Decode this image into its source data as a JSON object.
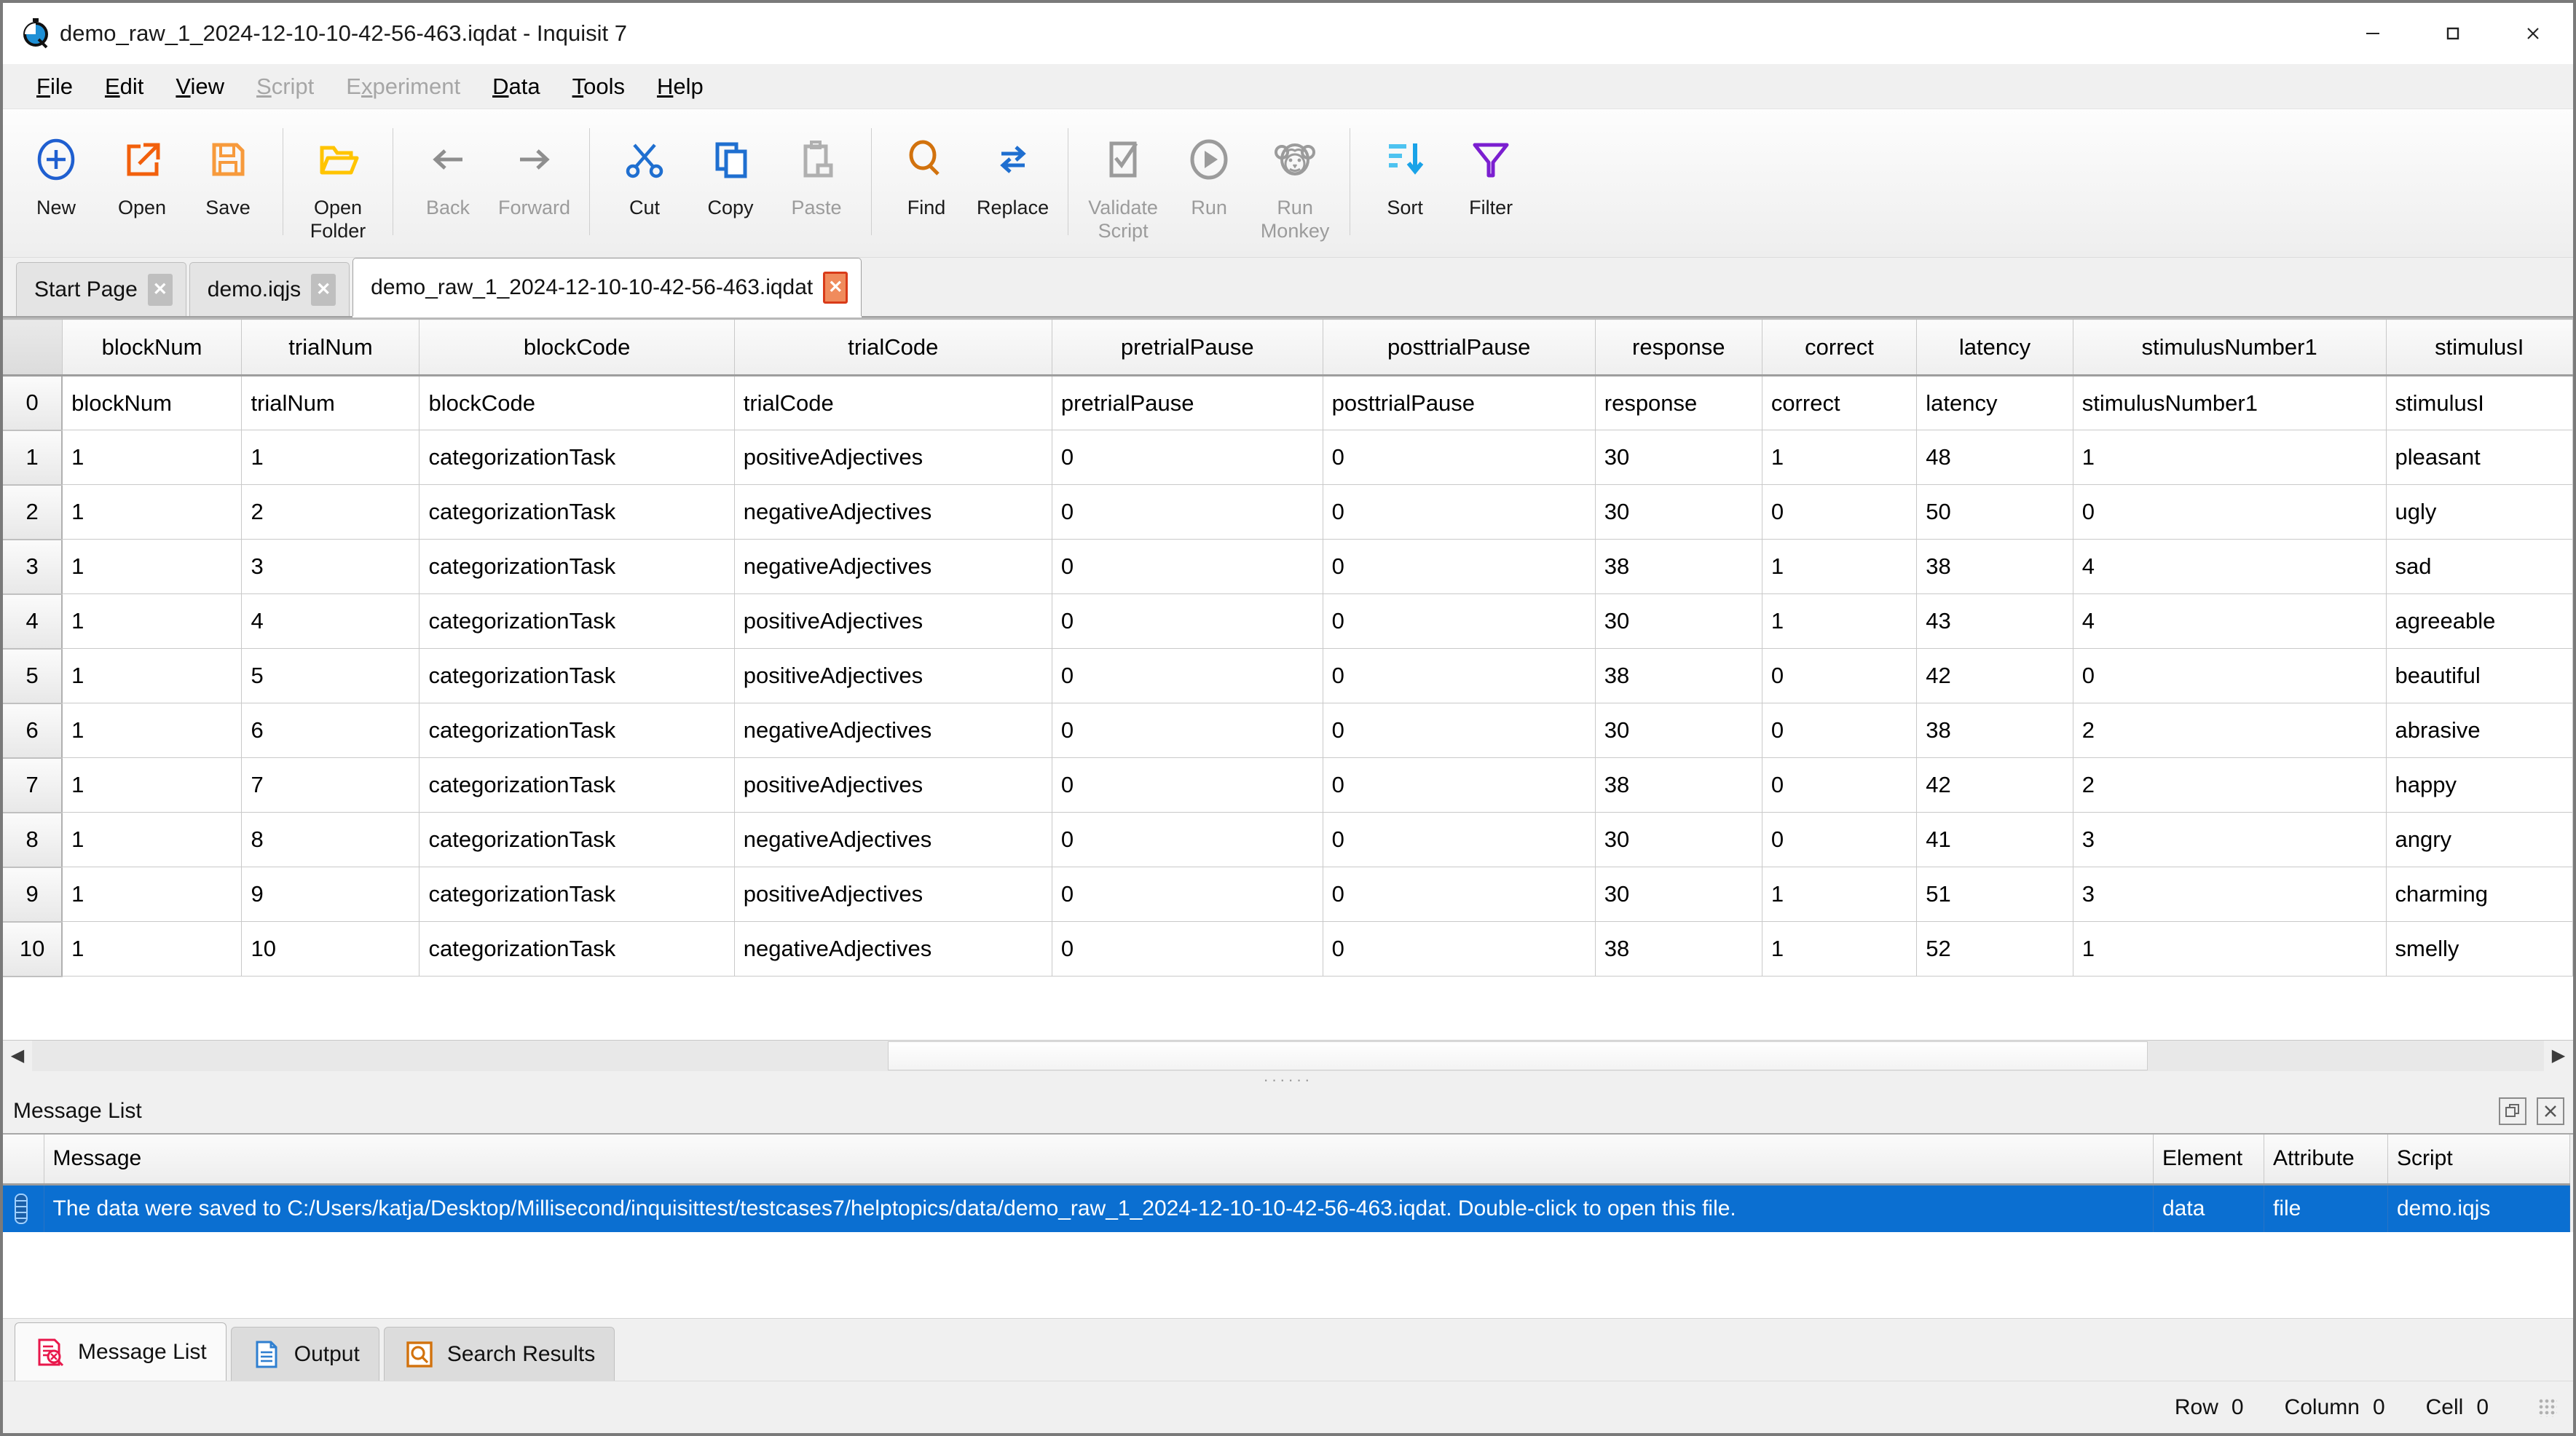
{
  "window": {
    "title": "demo_raw_1_2024-12-10-10-42-56-463.iqdat - Inquisit 7",
    "icon": "inquisit-stopwatch-icon",
    "minimize": "—",
    "maximize": "☐",
    "close": "✕"
  },
  "menubar": {
    "items": [
      {
        "label": "File",
        "mnemonic": "F",
        "disabled": false
      },
      {
        "label": "Edit",
        "mnemonic": "E",
        "disabled": false
      },
      {
        "label": "View",
        "mnemonic": "V",
        "disabled": false
      },
      {
        "label": "Script",
        "mnemonic": "S",
        "disabled": true
      },
      {
        "label": "Experiment",
        "mnemonic": "x",
        "disabled": true
      },
      {
        "label": "Data",
        "mnemonic": "D",
        "disabled": false
      },
      {
        "label": "Tools",
        "mnemonic": "T",
        "disabled": false
      },
      {
        "label": "Help",
        "mnemonic": "H",
        "disabled": false
      }
    ]
  },
  "toolbar": {
    "buttons": [
      {
        "label": "New",
        "icon": "plus-circle-icon",
        "disabled": false,
        "sep_after": false
      },
      {
        "label": "Open",
        "icon": "open-external-icon",
        "disabled": false,
        "sep_after": false
      },
      {
        "label": "Save",
        "icon": "floppy-disk-icon",
        "disabled": false,
        "sep_after": true
      },
      {
        "label": "Open\nFolder",
        "icon": "folder-open-icon",
        "disabled": false,
        "sep_after": true
      },
      {
        "label": "Back",
        "icon": "arrow-left-icon",
        "disabled": true,
        "sep_after": false
      },
      {
        "label": "Forward",
        "icon": "arrow-right-icon",
        "disabled": true,
        "sep_after": true
      },
      {
        "label": "Cut",
        "icon": "scissors-icon",
        "disabled": false,
        "sep_after": false
      },
      {
        "label": "Copy",
        "icon": "copy-icon",
        "disabled": false,
        "sep_after": false
      },
      {
        "label": "Paste",
        "icon": "paste-icon",
        "disabled": true,
        "sep_after": true
      },
      {
        "label": "Find",
        "icon": "magnifier-icon",
        "disabled": false,
        "sep_after": false
      },
      {
        "label": "Replace",
        "icon": "replace-arrows-icon",
        "disabled": false,
        "sep_after": true
      },
      {
        "label": "Validate\nScript",
        "icon": "checklist-icon",
        "disabled": true,
        "sep_after": false
      },
      {
        "label": "Run",
        "icon": "play-circle-icon",
        "disabled": true,
        "sep_after": false
      },
      {
        "label": "Run\nMonkey",
        "icon": "monkey-icon",
        "disabled": true,
        "sep_after": true
      },
      {
        "label": "Sort",
        "icon": "sort-descending-icon",
        "disabled": false,
        "sep_after": false
      },
      {
        "label": "Filter",
        "icon": "funnel-icon",
        "disabled": false,
        "sep_after": false
      }
    ]
  },
  "document_tabs": [
    {
      "label": "Start Page",
      "active": false,
      "close": "✕"
    },
    {
      "label": "demo.iqjs",
      "active": false,
      "close": "✕"
    },
    {
      "label": "demo_raw_1_2024-12-10-10-42-56-463.iqdat",
      "active": true,
      "close": "✕"
    }
  ],
  "grid": {
    "columns": [
      "blockNum",
      "trialNum",
      "blockCode",
      "trialCode",
      "pretrialPause",
      "posttrialPause",
      "response",
      "correct",
      "latency",
      "stimulusNumber1",
      "stimulusI"
    ],
    "row_labels": [
      "0",
      "1",
      "2",
      "3",
      "4",
      "5",
      "6",
      "7",
      "8",
      "9",
      "10"
    ],
    "rows": [
      [
        "blockNum",
        "trialNum",
        "blockCode",
        "trialCode",
        "pretrialPause",
        "posttrialPause",
        "response",
        "correct",
        "latency",
        "stimulusNumber1",
        "stimulusI"
      ],
      [
        "1",
        "1",
        "categorizationTask",
        "positiveAdjectives",
        "0",
        "0",
        "30",
        "1",
        "48",
        "1",
        "pleasant"
      ],
      [
        "1",
        "2",
        "categorizationTask",
        "negativeAdjectives",
        "0",
        "0",
        "30",
        "0",
        "50",
        "0",
        "ugly"
      ],
      [
        "1",
        "3",
        "categorizationTask",
        "negativeAdjectives",
        "0",
        "0",
        "38",
        "1",
        "38",
        "4",
        "sad"
      ],
      [
        "1",
        "4",
        "categorizationTask",
        "positiveAdjectives",
        "0",
        "0",
        "30",
        "1",
        "43",
        "4",
        "agreeable"
      ],
      [
        "1",
        "5",
        "categorizationTask",
        "positiveAdjectives",
        "0",
        "0",
        "38",
        "0",
        "42",
        "0",
        "beautiful"
      ],
      [
        "1",
        "6",
        "categorizationTask",
        "negativeAdjectives",
        "0",
        "0",
        "30",
        "0",
        "38",
        "2",
        "abrasive"
      ],
      [
        "1",
        "7",
        "categorizationTask",
        "positiveAdjectives",
        "0",
        "0",
        "38",
        "0",
        "42",
        "2",
        "happy"
      ],
      [
        "1",
        "8",
        "categorizationTask",
        "negativeAdjectives",
        "0",
        "0",
        "30",
        "0",
        "41",
        "3",
        "angry"
      ],
      [
        "1",
        "9",
        "categorizationTask",
        "positiveAdjectives",
        "0",
        "0",
        "30",
        "1",
        "51",
        "3",
        "charming"
      ],
      [
        "1",
        "10",
        "categorizationTask",
        "negativeAdjectives",
        "0",
        "0",
        "38",
        "1",
        "52",
        "1",
        "smelly"
      ]
    ]
  },
  "scrollbar": {
    "left_arrow": "◀",
    "right_arrow": "▶"
  },
  "message_panel": {
    "title": "Message List",
    "float_button": "❐",
    "close_button": "✕",
    "columns": [
      "Message",
      "Element",
      "Attribute",
      "Script"
    ],
    "rows": [
      {
        "icon": "message-info-icon",
        "message": "The data were saved to C:/Users/katja/Desktop/Millisecond/inquisittest/testcases7/helptopics/data/demo_raw_1_2024-12-10-10-42-56-463.iqdat. Double-click to open this file.",
        "element": "data",
        "attribute": "file",
        "script": "demo.iqjs",
        "selected": true
      }
    ]
  },
  "bottom_tabs": [
    {
      "label": "Message List",
      "icon": "message-list-icon",
      "active": true
    },
    {
      "label": "Output",
      "icon": "output-doc-icon",
      "active": false
    },
    {
      "label": "Search Results",
      "icon": "search-results-icon",
      "active": false
    }
  ],
  "statusbar": {
    "row_label": "Row",
    "row_value": "0",
    "column_label": "Column",
    "column_value": "0",
    "cell_label": "Cell",
    "cell_value": "0"
  },
  "colors": {
    "selection_blue": "#0b6fd1",
    "accent_orange": "#f07818",
    "accent_blue": "#1f6fd0",
    "accent_purple": "#7b1fd0",
    "accent_yellow": "#ffc400",
    "accent_red": "#e8174b",
    "disabled_gray": "#9b9b9b"
  }
}
